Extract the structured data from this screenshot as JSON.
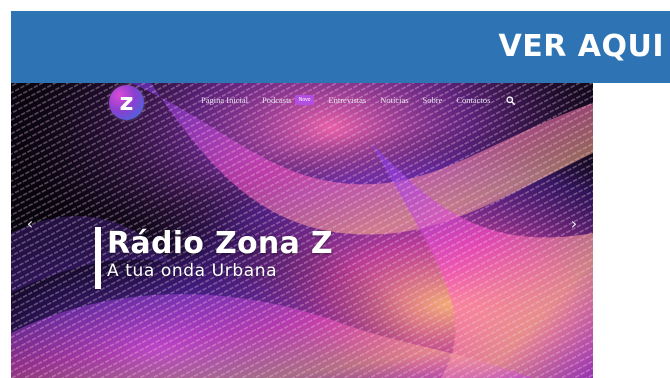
{
  "banner": {
    "text": "VER AQUI"
  },
  "logo": {
    "letter": "z"
  },
  "nav": {
    "items": [
      "Página Inicial",
      "Podcasts",
      "Entrevistas",
      "Notícias",
      "Sobre",
      "Contactos"
    ],
    "podcast_badge": "Novo"
  },
  "hero": {
    "title": "Rádio Zona Z",
    "subtitle": "A tua onda Urbana",
    "prev_arrow": "‹",
    "next_arrow": "›"
  },
  "colors": {
    "banner_bg": "#2e74b5",
    "hero_bg": "#06040c",
    "badge_bg": "#b34fe0",
    "accent_pink": "#ff4fc8",
    "accent_purple": "#8a3fd0",
    "accent_orange": "#ff9a55"
  },
  "icons": {
    "search": "search-icon",
    "prev": "chevron-left-icon",
    "next": "chevron-right-icon"
  }
}
